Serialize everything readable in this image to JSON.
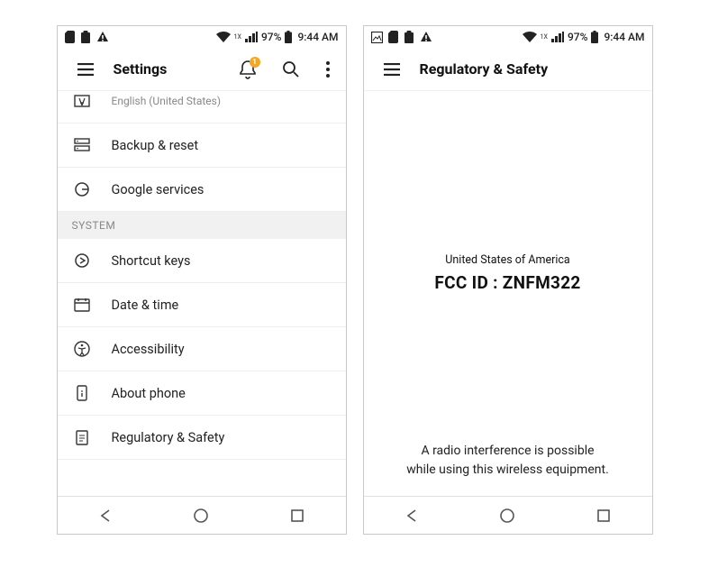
{
  "status": {
    "battery": "97%",
    "time": "9:44 AM",
    "network_small": "1X"
  },
  "screen1": {
    "title": "Settings",
    "notif_badge": "1",
    "partial_item": {
      "sublabel": "English (United States)"
    },
    "items": [
      {
        "label": "Backup & reset"
      },
      {
        "label": "Google services"
      }
    ],
    "system_header": "SYSTEM",
    "system_items": [
      {
        "label": "Shortcut keys"
      },
      {
        "label": "Date & time"
      },
      {
        "label": "Accessibility"
      },
      {
        "label": "About phone"
      },
      {
        "label": "Regulatory & Safety"
      }
    ]
  },
  "screen2": {
    "title": "Regulatory & Safety",
    "country": "United States of America",
    "fcc_id": "FCC ID : ZNFM322",
    "notice_line1": "A radio interference is possible",
    "notice_line2": "while using this wireless equipment."
  }
}
